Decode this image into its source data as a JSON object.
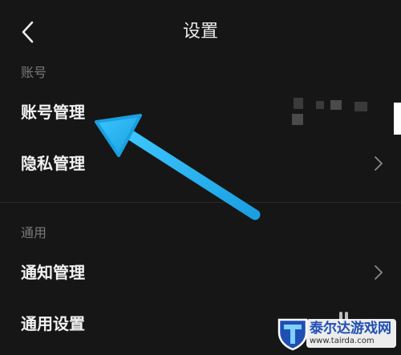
{
  "header": {
    "title": "设置"
  },
  "sections": [
    {
      "label": "账号",
      "items": [
        {
          "label": "账号管理"
        },
        {
          "label": "隐私管理"
        }
      ]
    },
    {
      "label": "通用",
      "items": [
        {
          "label": "通知管理"
        },
        {
          "label": "通用设置"
        }
      ]
    }
  ],
  "watermark": {
    "name": "泰尔达游戏网",
    "url": "www.tairda.com"
  },
  "colors": {
    "background": "#161616",
    "primary_text": "#f2f2f2",
    "secondary_text": "#7a7a7a",
    "annotation_arrow": "#2ab4ee"
  },
  "icons": {
    "back": "chevron-left-icon",
    "row_disclosure": "chevron-right-icon",
    "watermark_logo": "shield-t-logo-icon"
  }
}
